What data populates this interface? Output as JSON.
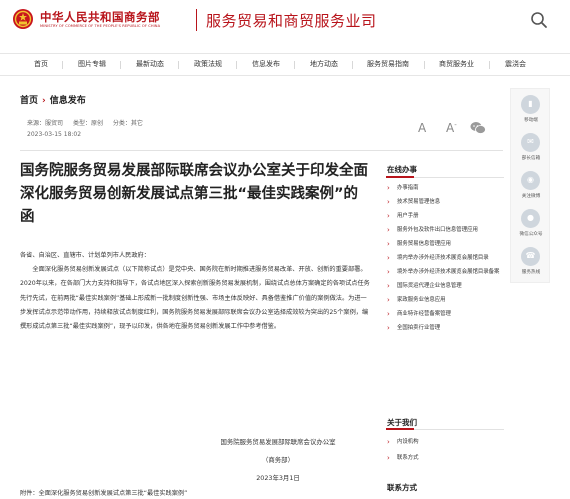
{
  "header": {
    "brand_cn": "中华人民共和国商务部",
    "brand_en": "MINISTRY OF COMMERCE OF THE PEOPLE'S REPUBLIC OF CHINA",
    "site_title": "服务贸易和商贸服务业司",
    "search_icon": "search-icon",
    "emblem_icon": "national-emblem-icon"
  },
  "nav": {
    "items": [
      "首页",
      "图片专辑",
      "最新动态",
      "政策法规",
      "信息发布",
      "地方动态",
      "服务贸易指南",
      "商贸服务业",
      "震浇会"
    ]
  },
  "breadcrumb": {
    "home": "首页",
    "current": "信息发布"
  },
  "meta": {
    "source": "来源：服贸司",
    "type": "类型：原创",
    "category": "分类：其它",
    "date": "2023-03-15 18:02"
  },
  "tools": {
    "font_large": "A",
    "font_small": "A",
    "font_small_sup": "-",
    "wechat_icon": "wechat-icon"
  },
  "article": {
    "title": "国务院服务贸易发展部际联席会议办公室关于印发全面深化服务贸易创新发展试点第三批“最佳实践案例”的函",
    "greeting": "各省、自治区、直辖市、计划单列市人民政府：",
    "body": "全面深化服务贸易创新发展试点（以下简称试点）是党中央、国务院在新时期推进服务贸易改革、开放、创新的重要部署。2020年以来，在各部门大力支持和指导下，各试点地区深入探索创新服务贸易发展机制，围绕试点总体方案确定的各项试点任务先行先试，在前两批“最佳实践案例”基础上形成新一批制度创新性强、市场主体反映好、具备借鉴推广价值的案例做法。为进一步发挥试点示范带动作用，持续释放试点制度红利，国务院服务贸易发展部际联席会议办公室选择成效较为突出的25个案例，编撰形成试点第三批“最佳实践案例”，现予以印发，供各地在服务贸易创新发展工作中参考借鉴。",
    "signature_org": "国务院服务贸易发展部际联席会议办公室",
    "signature_dept": "（商务部）",
    "signature_date": "2023年3月1日",
    "attachment": "附件：全面深化服务贸易创新发展试点第三批“最佳实践案例”"
  },
  "sidebar": {
    "online_title": "在线办事",
    "online_items": [
      "办事指南",
      "技术贸易管理信息",
      "用户手册",
      "服务外包及软件出口信息管理应用",
      "服务贸易信息管理应用",
      "境内举办涉外经济技术展览会展馆目录",
      "境外举办涉外经济技术展览会展馆目录备案",
      "国际货运代理企业信息管理",
      "家政服务业信息应用",
      "商业特许经营备案管理",
      "全国拍卖行业管理"
    ],
    "about_title": "关于我们",
    "about_items": [
      "内设机构",
      "联系方式"
    ],
    "contact_title": "联系方式"
  },
  "float_bar": {
    "items": [
      {
        "icon": "mobile-icon",
        "label": "移动端"
      },
      {
        "icon": "mail-icon",
        "label": "部长信箱"
      },
      {
        "icon": "weibo-icon",
        "label": "关注微博"
      },
      {
        "icon": "wechat-icon",
        "label": "微信公众号"
      },
      {
        "icon": "service-icon",
        "label": "服务热线"
      }
    ]
  },
  "colors": {
    "brand_red": "#b8141b",
    "text": "#333333",
    "muted": "#666666"
  }
}
